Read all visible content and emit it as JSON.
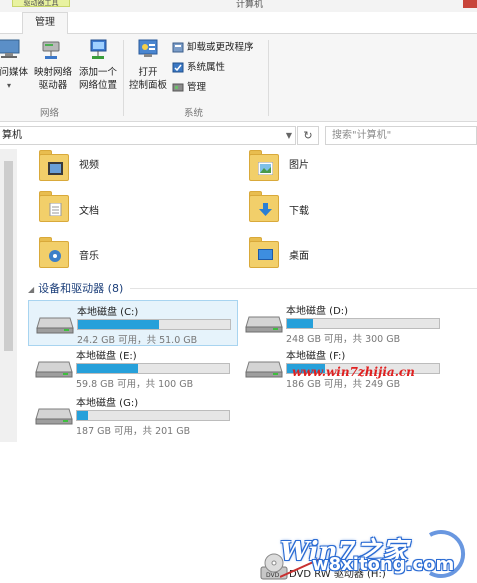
{
  "window": {
    "context_tab_label": "驱动器工具",
    "title": "计算机"
  },
  "ribbon": {
    "active_tab": "管理",
    "groups": [
      {
        "label": "网络",
        "buttons": [
          {
            "label_line1": "访问媒体",
            "icon": "media-icon"
          },
          {
            "label_line1": "映射网络",
            "label_line2": "驱动器",
            "icon": "map-network-drive-icon"
          },
          {
            "label_line1": "添加一个",
            "label_line2": "网络位置",
            "icon": "add-network-location-icon"
          }
        ]
      },
      {
        "label": "系统",
        "buttons": [
          {
            "label_line1": "打开",
            "label_line2": "控制面板",
            "icon": "control-panel-icon"
          }
        ],
        "small_buttons": [
          {
            "label": "卸载或更改程序",
            "icon": "uninstall-icon"
          },
          {
            "label": "系统属性",
            "icon": "system-properties-icon"
          },
          {
            "label": "管理",
            "icon": "manage-icon"
          }
        ]
      }
    ]
  },
  "address": {
    "path": "算机",
    "search_placeholder": "搜索\"计算机\""
  },
  "folders": [
    {
      "name": "视频",
      "icon": "videos-folder-icon"
    },
    {
      "name": "图片",
      "icon": "pictures-folder-icon"
    },
    {
      "name": "文档",
      "icon": "documents-folder-icon"
    },
    {
      "name": "下载",
      "icon": "downloads-folder-icon"
    },
    {
      "name": "音乐",
      "icon": "music-folder-icon"
    },
    {
      "name": "桌面",
      "icon": "desktop-folder-icon"
    }
  ],
  "devices_section": {
    "title": "设备和驱动器 (8)"
  },
  "drives": [
    {
      "name": "本地磁盘 (C:)",
      "info": "24.2 GB 可用，共 51.0 GB",
      "used_fraction": 0.53,
      "selected": true
    },
    {
      "name": "本地磁盘 (D:)",
      "info": "248 GB 可用，共 300 GB",
      "used_fraction": 0.17
    },
    {
      "name": "本地磁盘 (E:)",
      "info": "59.8 GB 可用，共 100 GB",
      "used_fraction": 0.4
    },
    {
      "name": "本地磁盘 (F:)",
      "info": "186 GB 可用，共 249 GB",
      "used_fraction": 0.25
    },
    {
      "name": "本地磁盘 (G:)",
      "info": "187 GB 可用，共 201 GB",
      "used_fraction": 0.07
    },
    {
      "name": "DVD RW 驱动器 (H:)"
    }
  ],
  "watermarks": {
    "url": "www.win7zhijia.cn",
    "logo_text": "Win7之家",
    "site": "w8xitong.com"
  },
  "colors": {
    "drive_bar_fill": "#26a0da",
    "selection_bg": "#e6f3fb",
    "section_title": "#1c3f7a"
  }
}
